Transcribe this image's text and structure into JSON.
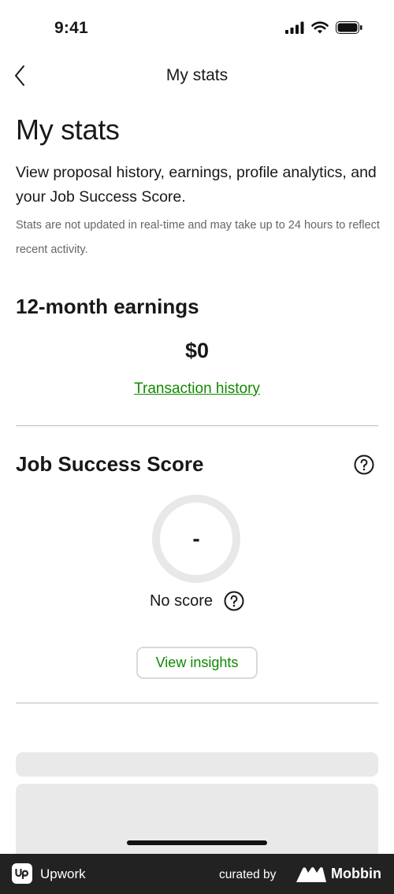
{
  "status_bar": {
    "time": "9:41",
    "icons": [
      "signal-icon",
      "wifi-icon",
      "battery-icon"
    ]
  },
  "nav": {
    "title": "My stats",
    "back_icon": "chevron-left-icon"
  },
  "page": {
    "title": "My stats",
    "intro": "View proposal history, earnings, profile analytics, and your Job Success Score.",
    "note": "Stats are not updated in real-time and may take up to 24 hours to reflect recent activity."
  },
  "earnings": {
    "title": "12-month earnings",
    "amount": "$0",
    "transaction_link": "Transaction history"
  },
  "job_success": {
    "title": "Job Success Score",
    "score_value": "-",
    "score_label": "No score",
    "insights_button": "View insights",
    "help_icon": "question-circle-icon"
  },
  "footer": {
    "app_name": "Upwork",
    "curated_by": "curated by",
    "brand": "Mobbin"
  },
  "colors": {
    "accent_green": "#108a00",
    "footer_bg": "#222222",
    "skeleton": "#e9e9e9"
  }
}
